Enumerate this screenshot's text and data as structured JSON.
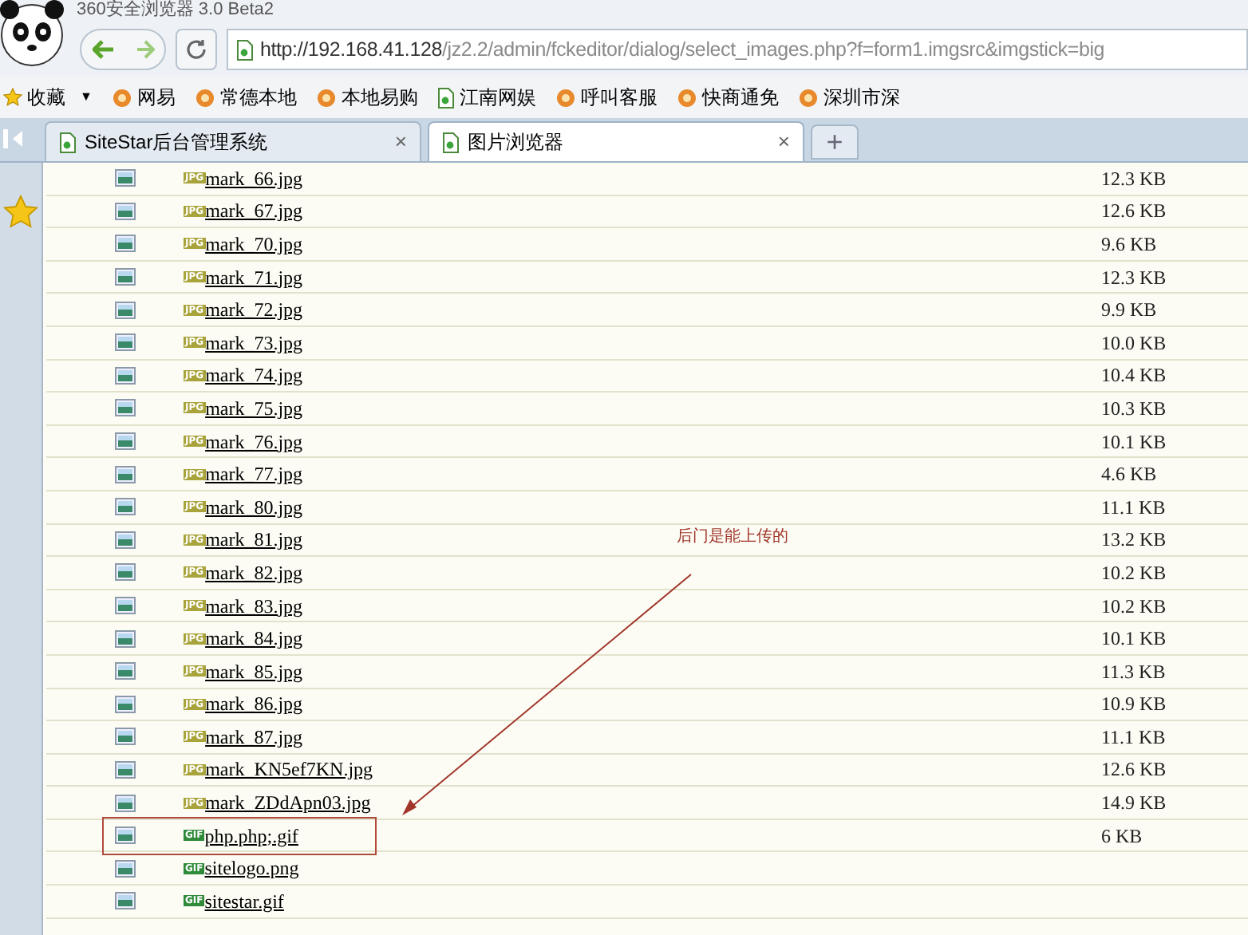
{
  "window": {
    "title": "360安全浏览器 3.0 Beta2"
  },
  "address_bar": {
    "host": "http://192.168.41.128",
    "path": "/jz2.2/admin/fckeditor/dialog/select_images.php?f=form1.imgsrc&imgstick=big"
  },
  "bookmarks": [
    {
      "label": "收藏",
      "kind": "favorites",
      "dropdown": "▼"
    },
    {
      "label": "网易",
      "kind": "site"
    },
    {
      "label": "常德本地",
      "kind": "site"
    },
    {
      "label": "本地易购",
      "kind": "site"
    },
    {
      "label": "江南网娱",
      "kind": "page"
    },
    {
      "label": "呼叫客服",
      "kind": "site"
    },
    {
      "label": "快商通免",
      "kind": "site"
    },
    {
      "label": "深圳市深",
      "kind": "site"
    }
  ],
  "tabs": [
    {
      "label": "SiteStar后台管理系统",
      "selected": false,
      "close": "×"
    },
    {
      "label": "图片浏览器",
      "selected": true,
      "close": "×"
    }
  ],
  "new_tab": "+",
  "files": [
    {
      "name": "mark_66.jpg",
      "badge": "JPG",
      "color": "#a8a33a",
      "size": "12.3 KB",
      "highlighted": false
    },
    {
      "name": "mark_67.jpg",
      "badge": "JPG",
      "color": "#a8a33a",
      "size": "12.6 KB",
      "highlighted": false
    },
    {
      "name": "mark_70.jpg",
      "badge": "JPG",
      "color": "#a8a33a",
      "size": "9.6 KB",
      "highlighted": false
    },
    {
      "name": "mark_71.jpg",
      "badge": "JPG",
      "color": "#a8a33a",
      "size": "12.3 KB",
      "highlighted": false
    },
    {
      "name": "mark_72.jpg",
      "badge": "JPG",
      "color": "#a8a33a",
      "size": "9.9 KB",
      "highlighted": false
    },
    {
      "name": "mark_73.jpg",
      "badge": "JPG",
      "color": "#a8a33a",
      "size": "10.0 KB",
      "highlighted": false
    },
    {
      "name": "mark_74.jpg",
      "badge": "JPG",
      "color": "#a8a33a",
      "size": "10.4 KB",
      "highlighted": false
    },
    {
      "name": "mark_75.jpg",
      "badge": "JPG",
      "color": "#a8a33a",
      "size": "10.3 KB",
      "highlighted": false
    },
    {
      "name": "mark_76.jpg",
      "badge": "JPG",
      "color": "#a8a33a",
      "size": "10.1 KB",
      "highlighted": false
    },
    {
      "name": "mark_77.jpg",
      "badge": "JPG",
      "color": "#a8a33a",
      "size": "4.6 KB",
      "highlighted": false
    },
    {
      "name": "mark_80.jpg",
      "badge": "JPG",
      "color": "#a8a33a",
      "size": "11.1 KB",
      "highlighted": false
    },
    {
      "name": "mark_81.jpg",
      "badge": "JPG",
      "color": "#a8a33a",
      "size": "13.2 KB",
      "highlighted": false
    },
    {
      "name": "mark_82.jpg",
      "badge": "JPG",
      "color": "#a8a33a",
      "size": "10.2 KB",
      "highlighted": false
    },
    {
      "name": "mark_83.jpg",
      "badge": "JPG",
      "color": "#a8a33a",
      "size": "10.2 KB",
      "highlighted": false
    },
    {
      "name": "mark_84.jpg",
      "badge": "JPG",
      "color": "#a8a33a",
      "size": "10.1 KB",
      "highlighted": false
    },
    {
      "name": "mark_85.jpg",
      "badge": "JPG",
      "color": "#a8a33a",
      "size": "11.3 KB",
      "highlighted": false
    },
    {
      "name": "mark_86.jpg",
      "badge": "JPG",
      "color": "#a8a33a",
      "size": "10.9 KB",
      "highlighted": false
    },
    {
      "name": "mark_87.jpg",
      "badge": "JPG",
      "color": "#a8a33a",
      "size": "11.1 KB",
      "highlighted": false
    },
    {
      "name": "mark_KN5ef7KN.jpg",
      "badge": "JPG",
      "color": "#a8a33a",
      "size": "12.6 KB",
      "highlighted": false
    },
    {
      "name": "mark_ZDdApn03.jpg",
      "badge": "JPG",
      "color": "#a8a33a",
      "size": "14.9 KB",
      "highlighted": false
    },
    {
      "name": "php.php;.gif",
      "badge": "GIF",
      "color": "#2f8a3a",
      "size": "6 KB",
      "highlighted": true
    },
    {
      "name": "sitelogo.png",
      "badge": "GIF",
      "color": "#2f8a3a",
      "highlighted": false
    },
    {
      "name": "sitestar.gif",
      "badge": "GIF",
      "color": "#2f8a3a",
      "highlighted": false
    }
  ],
  "annotation": {
    "text": "后门是能上传的"
  }
}
